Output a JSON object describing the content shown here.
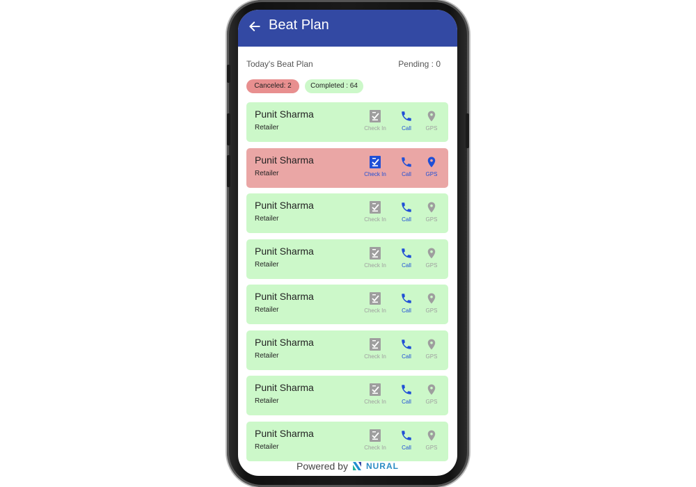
{
  "header": {
    "title": "Beat Plan"
  },
  "summary": {
    "label": "Today's Beat Plan",
    "pending": "Pending : 0"
  },
  "chips": {
    "canceled": "Canceled: 2",
    "completed": "Completed : 64"
  },
  "colors": {
    "appbar": "#3349a3",
    "card_completed": "#ccf8c9",
    "card_canceled": "#eaa6a5",
    "chip_canceled": "#e88f8f",
    "chip_completed": "#ccf8c9",
    "icon_active": "#1f4fd6",
    "icon_inactive": "#9e9e9e"
  },
  "visits": [
    {
      "name": "Punit Sharma",
      "role": "Retailer",
      "status": "completed"
    },
    {
      "name": "Punit Sharma",
      "role": "Retailer",
      "status": "canceled"
    },
    {
      "name": "Punit Sharma",
      "role": "Retailer",
      "status": "completed"
    },
    {
      "name": "Punit Sharma",
      "role": "Retailer",
      "status": "completed"
    },
    {
      "name": "Punit Sharma",
      "role": "Retailer",
      "status": "completed"
    },
    {
      "name": "Punit Sharma",
      "role": "Retailer",
      "status": "completed"
    },
    {
      "name": "Punit Sharma",
      "role": "Retailer",
      "status": "completed"
    },
    {
      "name": "Punit Sharma",
      "role": "Retailer",
      "status": "completed"
    }
  ],
  "actions": {
    "checkin": {
      "label": "Check In",
      "icon": "checklist-icon"
    },
    "call": {
      "label": "Call",
      "icon": "phone-icon"
    },
    "gps": {
      "label": "GPS",
      "icon": "map-pin-icon"
    }
  },
  "footer": {
    "powered_by": "Powered by",
    "brand": "NURAL",
    "logo_icon": "nural-logo-icon"
  }
}
